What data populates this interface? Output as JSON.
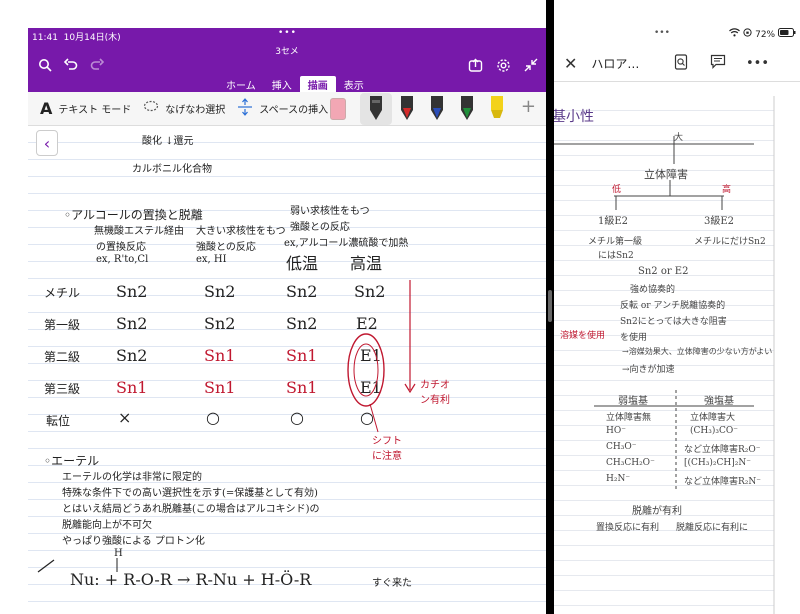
{
  "status": {
    "time": "11:41",
    "date": "10月14日(木)",
    "battery": "72%"
  },
  "left_app": {
    "doc_title": "3セメ",
    "tabs": [
      {
        "label": "ホーム",
        "active": false
      },
      {
        "label": "挿入",
        "active": false
      },
      {
        "label": "描画",
        "active": true
      },
      {
        "label": "表示",
        "active": false
      }
    ],
    "toolbar": {
      "text_mode_label": "テキスト モード",
      "lasso_label": "なげなわ選択",
      "space_label": "スペースの挿入"
    },
    "pens": [
      {
        "color": "#333333"
      },
      {
        "color": "#d42a2a"
      },
      {
        "color": "#2a4db8"
      },
      {
        "color": "#1f8f3a"
      },
      {
        "color": "#f3d21a"
      }
    ],
    "notes": {
      "top1": "酸化 ↓還元",
      "top2": "カルボニル化合物",
      "heading": "◦アルコールの置換と脱離",
      "col1a": "無機酸エステル経由",
      "col1b": "の置換反応",
      "col1c": "ex, R'to,Cl",
      "col2a": "大きい求核性をもつ",
      "col2b": "強酸との反応",
      "col2c": "ex, HI",
      "col3a": "弱い求核性をもつ",
      "col3b": "強酸との反応",
      "col3c": "ex,アルコール濃硫酸で加熱",
      "col3d": "低温",
      "col4d": "高温",
      "rows": [
        {
          "label": "メチル",
          "c1": "Sn2",
          "c2": "Sn2",
          "c3": "Sn2",
          "c4": "Sn2"
        },
        {
          "label": "第一級",
          "c1": "Sn2",
          "c2": "Sn2",
          "c3": "Sn2",
          "c4": "E2"
        },
        {
          "label": "第二級",
          "c1": "Sn2",
          "c2": "Sn1",
          "c3": "Sn1",
          "c4": "E1"
        },
        {
          "label": "第三級",
          "c1": "Sn1",
          "c2": "Sn1",
          "c3": "Sn1",
          "c4": "E1"
        },
        {
          "label": "転位",
          "c1": "×",
          "c2": "○",
          "c3": "○",
          "c4": "○"
        }
      ],
      "note_cation": "カチオン有利",
      "note_shift": "シフトに注意",
      "ether_heading": "◦エーテル",
      "ether1": "エーテルの化学は非常に限定的",
      "ether2": "特殊な条件下での高い選択性を示す(=保護基として有効)",
      "ether3": "とはいえ結局どうあれ脱離基(この場合はアルコキシド)の",
      "ether4": "脱離能向上が不可欠",
      "ether5": "やっぱり強酸による プロトン化",
      "reaction": "Nu: + R-O-R → R-Nu + H-Ö-R",
      "reaction_h": "H",
      "reaction_note": "すぐ来た"
    }
  },
  "right_app": {
    "title": "ハロア…",
    "notes": {
      "top": "基小性",
      "t1": "大",
      "t2": "立体障害",
      "t3": "低",
      "t4": "高",
      "l1": "1級E2",
      "l2": "メチル第一級",
      "l3": "にはSn2",
      "r1": "3級E2",
      "r2": "メチルにだけSn2",
      "m1": "Sn2 or E2",
      "m2": "強め協奏的",
      "m3": "反転 or アンチ脱離協奏的",
      "m4": "Sn2にとっては大きな阻害",
      "m5": "を使用",
      "m6": "→溶媒効果大、立体障害の少ない方がよい",
      "m7": "→向きが加速",
      "side": "溶媒を使用",
      "h1": "弱塩基",
      "h2": "強塩基",
      "a1": "立体障害無",
      "a2": "HO⁻",
      "a3": "CH₃O⁻",
      "a4": "CH₃CH₂O⁻",
      "a5": "H₂N⁻",
      "b1": "立体障害大",
      "b2": "(CH₃)₃CO⁻",
      "b3": "など立体障害R₂O⁻",
      "b4": "[(CH₃)₂CH]₂N⁻",
      "b5": "など立体障害R₂N⁻",
      "f1": "脱離が有利",
      "f2": "置換反応に有利",
      "f3": "脱離反応に有利に"
    }
  }
}
